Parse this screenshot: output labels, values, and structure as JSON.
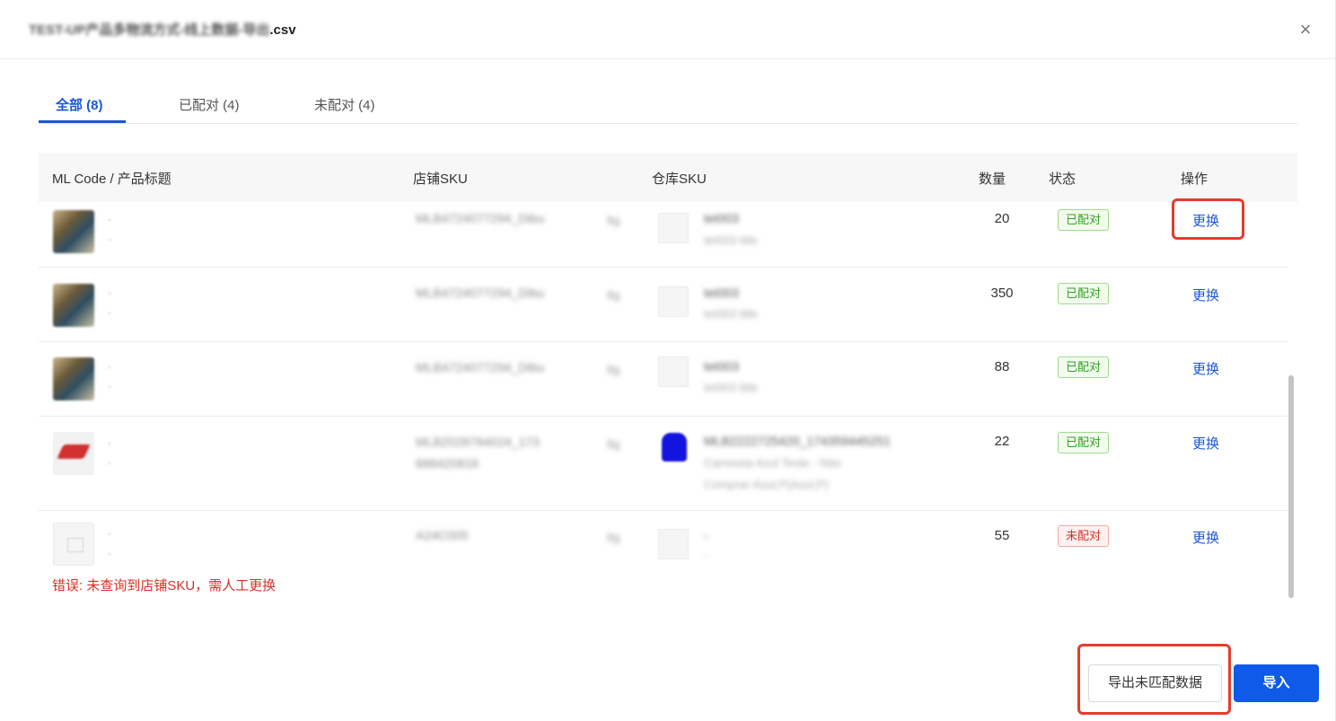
{
  "dialog": {
    "title_blurred": "TEST-UP产品多物流方式-线上数据-导出",
    "title_suffix": ".csv",
    "close_label": "×"
  },
  "tabs": [
    {
      "label": "全部 (8)",
      "active": true
    },
    {
      "label": "已配对 (4)",
      "active": false
    },
    {
      "label": "未配对 (4)",
      "active": false
    }
  ],
  "columns": {
    "product": "ML Code / 产品标题",
    "shop_sku": "店铺SKU",
    "warehouse_sku": "仓库SKU",
    "quantity": "数量",
    "status": "状态",
    "action": "操作"
  },
  "rows": [
    {
      "dash1": "-",
      "dash2": "-",
      "shop_sku": "MLB4724077294_Dibu",
      "unit": "8g",
      "wh_main": "tet003",
      "wh_sub": "tet003 title",
      "quantity": "20",
      "status": "已配对",
      "action": "更换"
    },
    {
      "dash1": "-",
      "dash2": "-",
      "shop_sku": "MLB4724077294_Dibu",
      "unit": "8g",
      "wh_main": "tet003",
      "wh_sub": "tet003 title",
      "quantity": "350",
      "status": "已配对",
      "action": "更换"
    },
    {
      "dash1": "-",
      "dash2": "-",
      "shop_sku": "MLB4724077294_Dibu",
      "unit": "8g",
      "wh_main": "tet003",
      "wh_sub": "tet003 title",
      "quantity": "88",
      "status": "已配对",
      "action": "更换"
    },
    {
      "dash1": "-",
      "dash2": "-",
      "shop_sku_line1": "MLB2028784024_173",
      "shop_sku_line2": "688420816",
      "unit": "8g",
      "wh_main": "MLB2222725420_174359445251",
      "wh_sub_line1": "Camiseta Azul Teste - Nào",
      "wh_sub_line2": "Comprar-Azul,P(Azul,P)",
      "quantity": "22",
      "status": "已配对",
      "action": "更换"
    },
    {
      "dash1": "-",
      "dash2": "-",
      "shop_sku": "A24C005",
      "unit": "8g",
      "wh_main": "-",
      "wh_sub": "-",
      "quantity": "55",
      "status": "未配对",
      "action": "更换",
      "error": "错误: 未查询到店铺SKU，需人工更换"
    }
  ],
  "footer": {
    "export_label": "导出未匹配数据",
    "import_label": "导入"
  },
  "colors": {
    "accent": "#1a56d6",
    "primary_button": "#0f5ae8",
    "matched": "#2ea121",
    "unmatched": "#d93026",
    "highlight": "#e53b2c"
  }
}
